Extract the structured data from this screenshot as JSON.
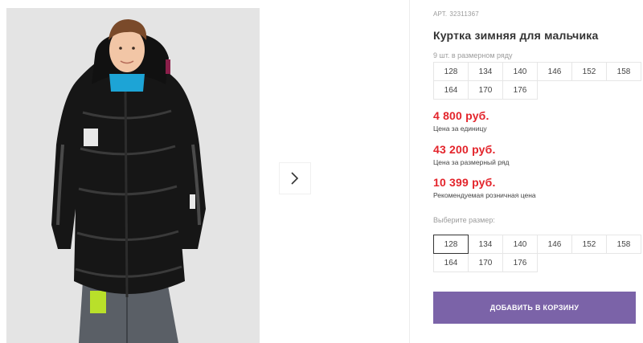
{
  "product": {
    "article_label": "АРТ.",
    "article_number": "32311367",
    "title": "Куртка зимняя для мальчика"
  },
  "pack": {
    "note": "9 шт. в размерном ряду",
    "sizes": [
      "128",
      "134",
      "140",
      "146",
      "152",
      "158",
      "164",
      "170",
      "176"
    ]
  },
  "prices": [
    {
      "value": "4 800 руб.",
      "label": "Цена за единицу"
    },
    {
      "value": "43 200 руб.",
      "label": "Цена за размерный ряд"
    },
    {
      "value": "10 399 руб.",
      "label": "Рекомендуемая розничная цена"
    }
  ],
  "size_picker": {
    "label": "Выберите размер:",
    "selected": "128",
    "options": [
      "128",
      "134",
      "140",
      "146",
      "152",
      "158",
      "164",
      "170",
      "176"
    ]
  },
  "cart": {
    "button_label": "ДОБАВИТЬ В КОРЗИНУ"
  },
  "colors": {
    "price_red": "#e3242b",
    "cart_purple": "#7b63a8"
  },
  "icons": {
    "next": "chevron-right-icon"
  }
}
